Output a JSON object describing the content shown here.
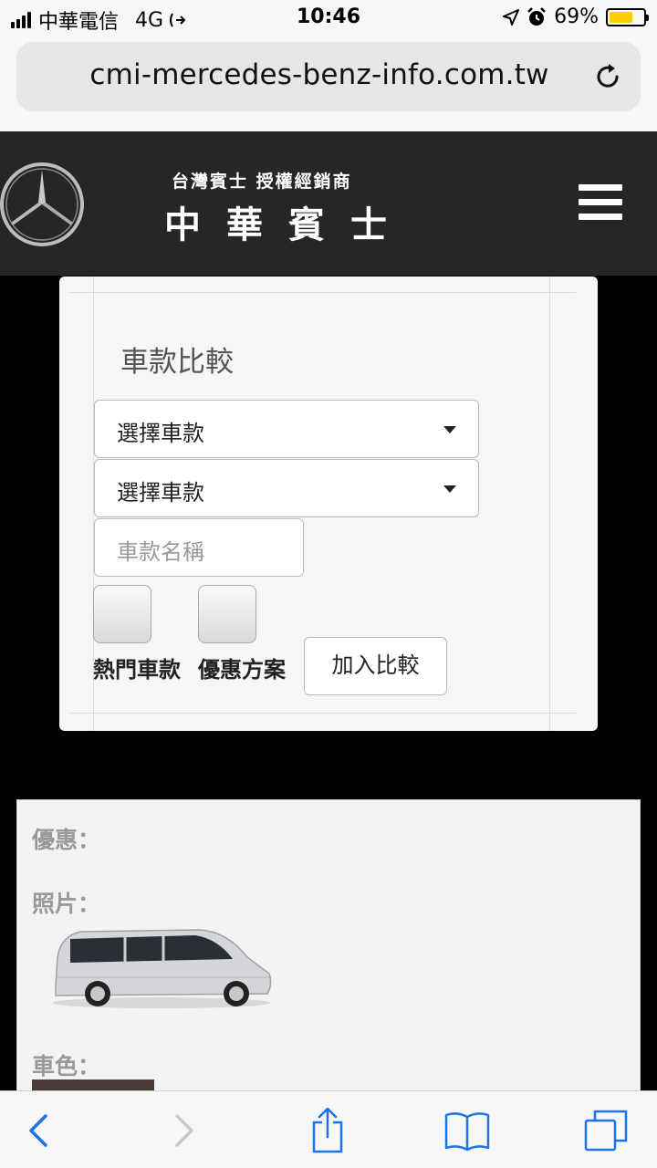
{
  "status": {
    "carrier": "中華電信",
    "network": "4G",
    "time": "10:46",
    "battery": "69%",
    "battery_level": 0.69,
    "battery_color": "#ffcc00"
  },
  "browser": {
    "url": "cmi-mercedes-benz-info.com.tw"
  },
  "header": {
    "dealer_subtitle": "台灣賓士 授權經銷商",
    "dealer_name": "中華賓士"
  },
  "compare": {
    "title": "車款比較",
    "select1_label": "選擇車款",
    "select2_label": "選擇車款",
    "name_placeholder": "車款名稱",
    "hot_label": "熱門車款",
    "promo_label": "優惠方案",
    "add_button": "加入比較"
  },
  "result": {
    "promo_label": "優惠：",
    "photo_label": "照片：",
    "color_label": "車色："
  },
  "icons": {
    "back": "chevron-left-icon",
    "forward": "chevron-right-icon",
    "share": "share-icon",
    "bookmarks": "book-icon",
    "tabs": "tabs-icon",
    "reload": "reload-icon",
    "menu": "hamburger-icon"
  },
  "colors": {
    "accent": "#1a73e8",
    "header_bg": "#262626"
  }
}
